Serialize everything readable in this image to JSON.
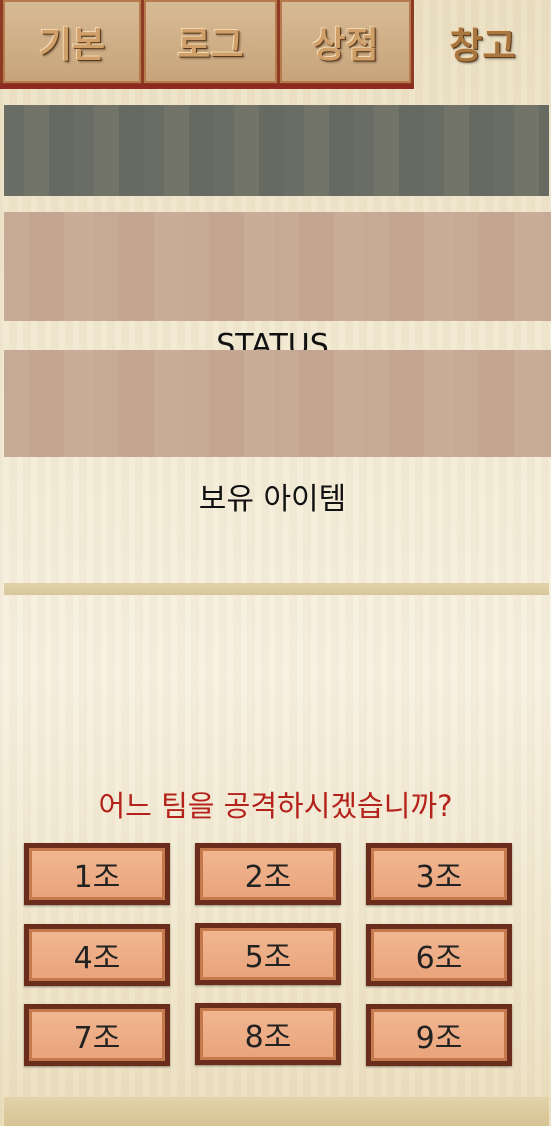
{
  "tabs": [
    {
      "label": "기본",
      "active": false
    },
    {
      "label": "로그",
      "active": false
    },
    {
      "label": "상점",
      "active": false
    },
    {
      "label": "창고",
      "active": true
    }
  ],
  "sections": {
    "status_label": "STATUS",
    "items_label": "보유 아이템"
  },
  "question": "어느 팀을 공격하시겠습니까?",
  "teams": [
    "1조",
    "2조",
    "3조",
    "4조",
    "5조",
    "6조",
    "7조",
    "8조",
    "9조"
  ],
  "colors": {
    "tab_border": "#8e3b24",
    "question_text": "#b3221b",
    "button_fill": "#eeaa80",
    "button_border": "#6a2c1b",
    "gray_panel": "#6a6d63",
    "rose_panel": "#c6aa95"
  }
}
